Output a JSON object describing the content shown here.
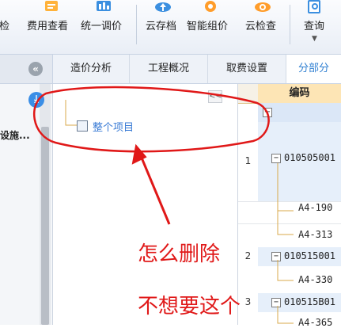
{
  "toolbar": {
    "buttons": [
      {
        "label": "自检",
        "icon": "check-icon"
      },
      {
        "label": "费用查看",
        "icon": "fee-view-icon"
      },
      {
        "label": "统一调价",
        "icon": "adjust-price-icon"
      },
      {
        "label": "云存档",
        "icon": "cloud-archive-icon"
      },
      {
        "label": "智能组价",
        "icon": "smart-price-icon"
      },
      {
        "label": "云检查",
        "icon": "cloud-check-icon"
      },
      {
        "label": "查询",
        "icon": "query-icon"
      }
    ]
  },
  "tabs": [
    {
      "label": "造价分析",
      "active": false
    },
    {
      "label": "工程概况",
      "active": false
    },
    {
      "label": "取费设置",
      "active": false
    },
    {
      "label": "分部分",
      "active": true
    }
  ],
  "left_panel": {
    "item_label": "设施..."
  },
  "tree": {
    "root_label": "整个项目",
    "collapse_label": "<<"
  },
  "grid": {
    "header": "编码",
    "rows": [
      {
        "num": "1",
        "code": "010505001",
        "expander": "−"
      },
      {
        "num": "",
        "code": "A4-190",
        "expander": ""
      },
      {
        "num": "",
        "code": "A4-313",
        "expander": ""
      },
      {
        "num": "2",
        "code": "010515001",
        "expander": "−"
      },
      {
        "num": "",
        "code": "A4-330",
        "expander": ""
      },
      {
        "num": "3",
        "code": "010515B01",
        "expander": "−"
      },
      {
        "num": "",
        "code": "A4-365",
        "expander": ""
      }
    ]
  },
  "annotation": {
    "line1": "怎么删除",
    "line2": "不想要这个",
    "color": "#e01818"
  },
  "colors": {
    "accent": "#2f7fd1",
    "header": "#fde5b5"
  }
}
